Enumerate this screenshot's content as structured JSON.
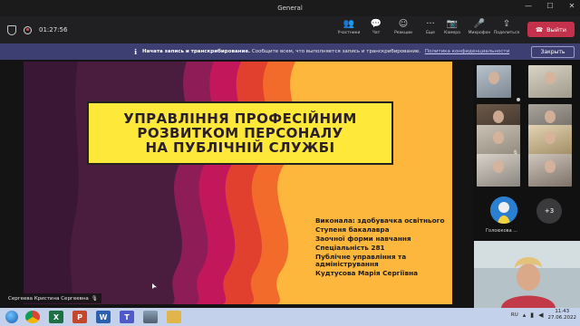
{
  "window": {
    "title": "General",
    "controls": [
      "—",
      "☐",
      "✕"
    ]
  },
  "toolbar": {
    "timer": "01:27:56",
    "center_buttons": [
      {
        "icon": "people-icon",
        "glyph": "👥",
        "label": "Участники"
      },
      {
        "icon": "chat-icon",
        "glyph": "💬",
        "label": "Чат"
      },
      {
        "icon": "reactions-icon",
        "glyph": "☺",
        "label": "Реакции"
      },
      {
        "icon": "more-icon",
        "glyph": "···",
        "label": "Еще"
      }
    ],
    "right_buttons": [
      {
        "icon": "camera-icon",
        "glyph": "📷",
        "label": "Камера"
      },
      {
        "icon": "microphone-icon",
        "glyph": "🎤",
        "label": "Микрофон"
      },
      {
        "icon": "share-icon",
        "glyph": "⇪",
        "label": "Поделиться"
      }
    ],
    "leave_label": "Выйти"
  },
  "banner": {
    "bold": "Начата запись и транскрибирование.",
    "text": "Сообщите всем, что выполняется запись и транскрибирование.",
    "link": "Политика конфиденциальности",
    "close_label": "Закрыть"
  },
  "slide": {
    "title_lines": [
      "УПРАВЛІННЯ ПРОФЕСІЙНИМ",
      "РОЗВИТКОМ ПЕРСОНАЛУ",
      "НА ПУБЛІЧНІЙ СЛУЖБІ"
    ],
    "info": [
      "Виконала: здобувачка освітнього",
      "Ступеня бакалавра",
      "Заочної форми навчання",
      "Спеціальність 281",
      "Публічне управління та адміністрування",
      "Кудтусова Марія Сергіївна"
    ],
    "colors": {
      "left": "#4a1d3f",
      "mid": "#c2185b",
      "orange": "#f5722a",
      "right": "#fdb73c",
      "title_bg": "#fee93b"
    }
  },
  "presenter": {
    "name": "Сергеева Кристина Сергеевна"
  },
  "participants": {
    "avatar_label": "Голоюкова ...",
    "more_label": "+3"
  },
  "taskbar": {
    "apps": [
      {
        "icon": "chrome-icon",
        "letter": "",
        "color": "#2a9d4a"
      },
      {
        "icon": "excel-icon",
        "letter": "X",
        "color": "#1d7044"
      },
      {
        "icon": "powerpoint-icon",
        "letter": "P",
        "color": "#c5462a"
      },
      {
        "icon": "word-icon",
        "letter": "W",
        "color": "#2b5faf"
      },
      {
        "icon": "teams-icon",
        "letter": "T",
        "color": "#5059c9"
      },
      {
        "icon": "photo-icon",
        "letter": "",
        "color": "#6a7b8c"
      },
      {
        "icon": "folder-icon",
        "letter": "",
        "color": "#e0b54a"
      }
    ],
    "lang": "RU",
    "time": "11:43",
    "date": "27.06.2022"
  }
}
